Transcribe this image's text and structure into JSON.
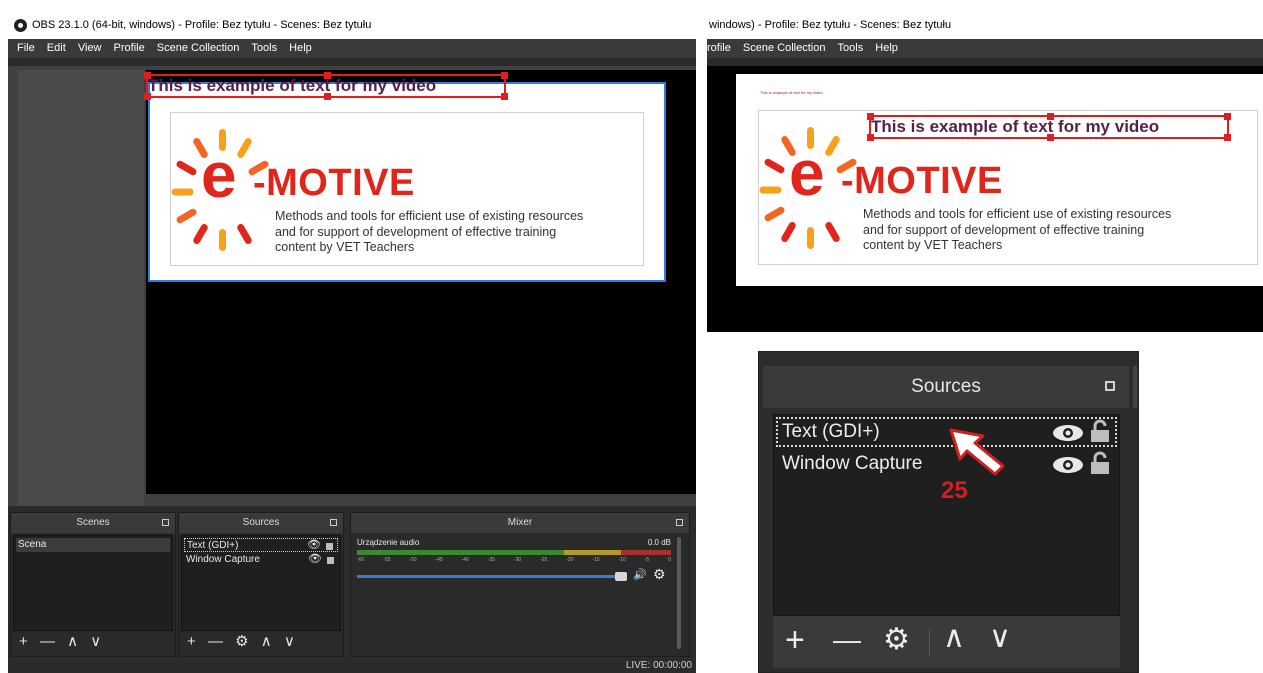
{
  "left_window": {
    "title": "OBS 23.1.0 (64-bit, windows) - Profile: Bez tytułu - Scenes: Bez tytułu",
    "menu": [
      "File",
      "Edit",
      "View",
      "Profile",
      "Scene Collection",
      "Tools",
      "Help"
    ],
    "overlay_text": "This is example of text for my video",
    "logo": {
      "e": "e",
      "word": "-MOTIVE",
      "description": [
        "Methods and tools for efficient use of existing resources",
        "and for support of development of effective training",
        "content by VET Teachers"
      ]
    },
    "scenes_dock": {
      "title": "Scenes",
      "items": [
        "Scena"
      ],
      "toolbar": [
        "+",
        "—",
        "∧",
        "∨"
      ]
    },
    "sources_dock": {
      "title": "Sources",
      "items": [
        {
          "label": "Text (GDI+)",
          "selected": true
        },
        {
          "label": "Window Capture",
          "selected": false
        }
      ],
      "toolbar": [
        "+",
        "—",
        "⚙",
        "∧",
        "∨"
      ]
    },
    "mixer_dock": {
      "title": "Mixer",
      "device": "Urządzenie audio",
      "level": "0.0 dB",
      "scale": [
        "-60",
        "-55",
        "-50",
        "-45",
        "-40",
        "-35",
        "-30",
        "-25",
        "-20",
        "-15",
        "-10",
        "-5",
        "0"
      ]
    },
    "status": "LIVE: 00:00:00"
  },
  "right_window": {
    "title": "windows) - Profile: Bez tytułu - Scenes: Bez tytułu",
    "menu": [
      "rofile",
      "Scene Collection",
      "Tools",
      "Help"
    ],
    "tiny_text": "This is example of text for my video",
    "overlay_text": "This is example of text for my video"
  },
  "zoom_panel": {
    "title": "Sources",
    "items": [
      {
        "label": "Text (GDI+)",
        "selected": true
      },
      {
        "label": "Window Capture",
        "selected": false
      }
    ],
    "toolbar": [
      "+",
      "—",
      "⚙",
      "∧",
      "∨"
    ],
    "step_number": "25"
  },
  "colors": {
    "accent_red": "#e1251b",
    "selection_red": "#e01e1e",
    "selection_blue": "#2e7de1",
    "text_source_color": "#5a1f45",
    "sun_orange": "#f7a11a"
  }
}
